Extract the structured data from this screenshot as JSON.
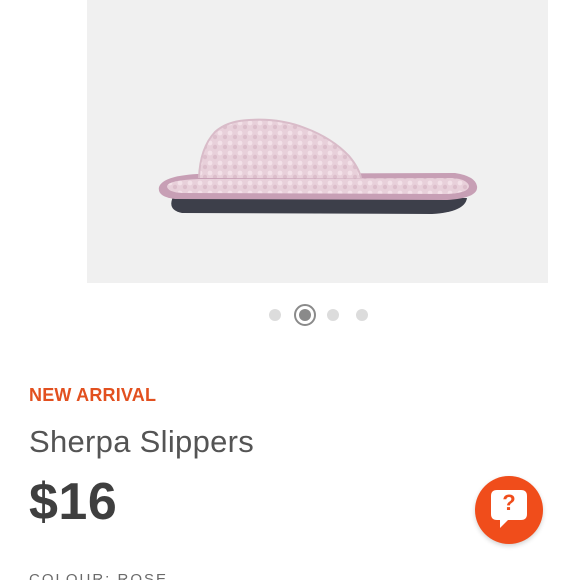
{
  "product": {
    "image_alt": "pink sherpa open-toe slide slipper",
    "image_index": 2,
    "image_count": 4,
    "badge": "NEW ARRIVAL",
    "name": "Sherpa Slippers",
    "price": "$16",
    "colour_label": "COLOUR: ROSE"
  },
  "help_button": {
    "icon": "question-chat-bubble-icon",
    "glyph": "?"
  },
  "colors": {
    "accent": "#f04d1b",
    "badge_text": "#e2501f",
    "gallery_bg": "#f0f0f0",
    "slipper_pink": "#e7cfd8",
    "slipper_trim": "#c79fb5",
    "sole": "#3d3f4a"
  }
}
